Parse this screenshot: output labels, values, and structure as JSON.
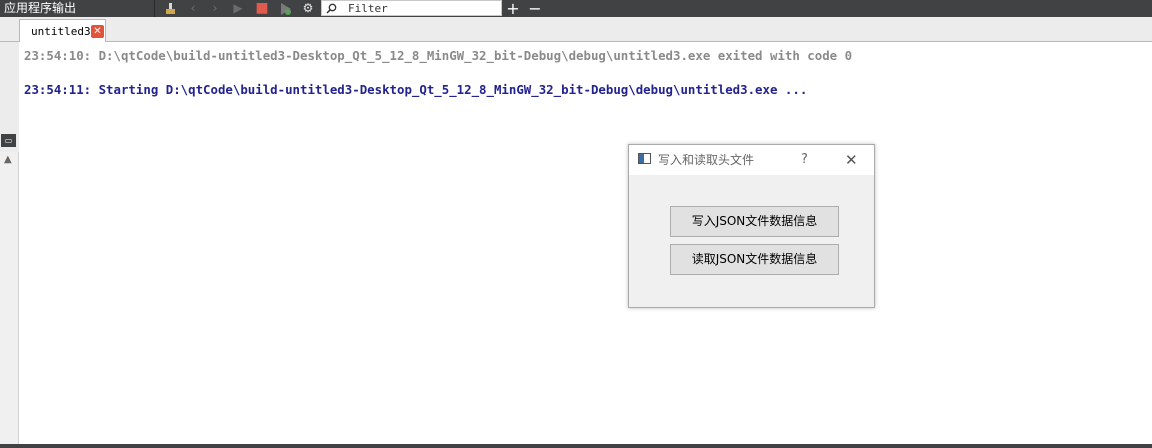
{
  "panel": {
    "title": "应用程序输出"
  },
  "toolbar": {
    "icons": {
      "clean": "clean-icon",
      "prev": "‹",
      "next": "›",
      "run": "▶",
      "stop": "■",
      "attach": "debug-attach-icon",
      "settings": "⚙",
      "add": "+",
      "remove": "−"
    },
    "filter_placeholder": "Filter"
  },
  "tab": {
    "label": "untitled3",
    "close": "✕"
  },
  "output": {
    "lines": [
      "23:54:10: D:\\qtCode\\build-untitled3-Desktop_Qt_5_12_8_MinGW_32_bit-Debug\\debug\\untitled3.exe exited with code 0",
      "23:54:11: Starting D:\\qtCode\\build-untitled3-Desktop_Qt_5_12_8_MinGW_32_bit-Debug\\debug\\untitled3.exe ..."
    ]
  },
  "dialog": {
    "title": "写入和读取头文件",
    "help": "?",
    "close": "✕",
    "write_button": "写入JSON文件数据信息",
    "read_button": "读取JSON文件数据信息"
  },
  "colors": {
    "toolbar_bg": "#404244",
    "exit_text": "#8a8a8a",
    "start_text": "#23238e",
    "stop_icon": "#e05a4e",
    "run_icon": "#6b6b6b"
  }
}
